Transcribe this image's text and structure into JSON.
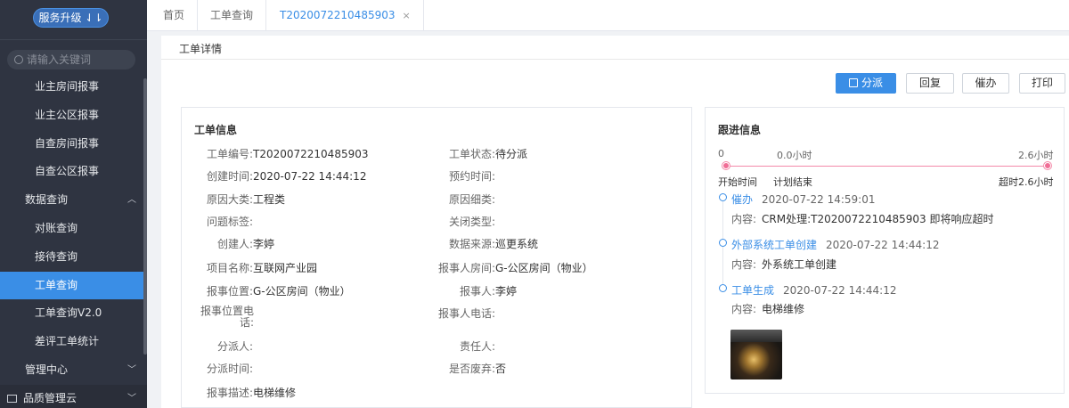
{
  "sidebar": {
    "upgrade_label": "服务升级 ⇃⇂",
    "search_placeholder": "请输入关键词",
    "items": [
      {
        "label": "业主房间报事",
        "type": "sub"
      },
      {
        "label": "业主公区报事",
        "type": "sub"
      },
      {
        "label": "自查房间报事",
        "type": "sub"
      },
      {
        "label": "自查公区报事",
        "type": "sub"
      },
      {
        "label": "数据查询",
        "type": "group",
        "chevron": "up"
      },
      {
        "label": "对账查询",
        "type": "sub"
      },
      {
        "label": "接待查询",
        "type": "sub"
      },
      {
        "label": "工单查询",
        "type": "sub",
        "active": true
      },
      {
        "label": "工单查询V2.0",
        "type": "sub"
      },
      {
        "label": "差评工单统计",
        "type": "sub"
      },
      {
        "label": "管理中心",
        "type": "group",
        "chevron": "down"
      },
      {
        "label": "品质管理云",
        "type": "bottom",
        "chevron": "down"
      }
    ]
  },
  "tabs": {
    "home": "首页",
    "query": "工单查询",
    "active": "T2020072210485903",
    "close": "×"
  },
  "page": {
    "title": "工单详情"
  },
  "actions": {
    "dispatch": "分派",
    "reply": "回复",
    "urge": "催办",
    "print": "打印"
  },
  "info": {
    "title": "工单信息",
    "left": [
      {
        "label": "工单编号:",
        "value": "T2020072210485903"
      },
      {
        "label": "创建时间:",
        "value": "2020-07-22 14:44:12"
      },
      {
        "label": "原因大类:",
        "value": "工程类"
      },
      {
        "label": "问题标签:",
        "value": ""
      },
      {
        "label": "创建人:",
        "value": "李婷"
      },
      {
        "label": "项目名称:",
        "value": "互联网产业园"
      },
      {
        "label": "报事位置:",
        "value": "G-公区房间（物业）"
      },
      {
        "label": "报事位置电话:",
        "value": ""
      },
      {
        "label": "分派人:",
        "value": ""
      },
      {
        "label": "分派时间:",
        "value": ""
      },
      {
        "label": "报事描述:",
        "value": "电梯维修"
      }
    ],
    "right": [
      {
        "label": "工单状态:",
        "value": "待分派"
      },
      {
        "label": "预约时间:",
        "value": ""
      },
      {
        "label": "原因细类:",
        "value": ""
      },
      {
        "label": "关闭类型:",
        "value": ""
      },
      {
        "label": "数据来源:",
        "value": "巡更系统"
      },
      {
        "label": "报事人房间:",
        "value": "G-公区房间（物业）"
      },
      {
        "label": "报事人:",
        "value": "李婷"
      },
      {
        "label": "报事人电话:",
        "value": ""
      },
      {
        "label": "责任人:",
        "value": ""
      },
      {
        "label": "是否废弃:",
        "value": "否"
      }
    ]
  },
  "followup": {
    "title": "跟进信息",
    "timeline": {
      "start_value": "0",
      "mid_value": "0.0小时",
      "end_value": "2.6小时",
      "start_label": "开始时间",
      "mid_label": "计划结束",
      "end_label": "超时2.6小时"
    },
    "events": [
      {
        "type": "催办",
        "time": "2020-07-22 14:59:01",
        "content_label": "内容:",
        "content": "CRM处理:T2020072210485903 即将响应超时"
      },
      {
        "type": "外部系统工单创建",
        "time": "2020-07-22 14:44:12",
        "content_label": "内容:",
        "content": "外系统工单创建"
      },
      {
        "type": "工单生成",
        "time": "2020-07-22 14:44:12",
        "content_label": "内容:",
        "content": "电梯维修"
      }
    ]
  }
}
